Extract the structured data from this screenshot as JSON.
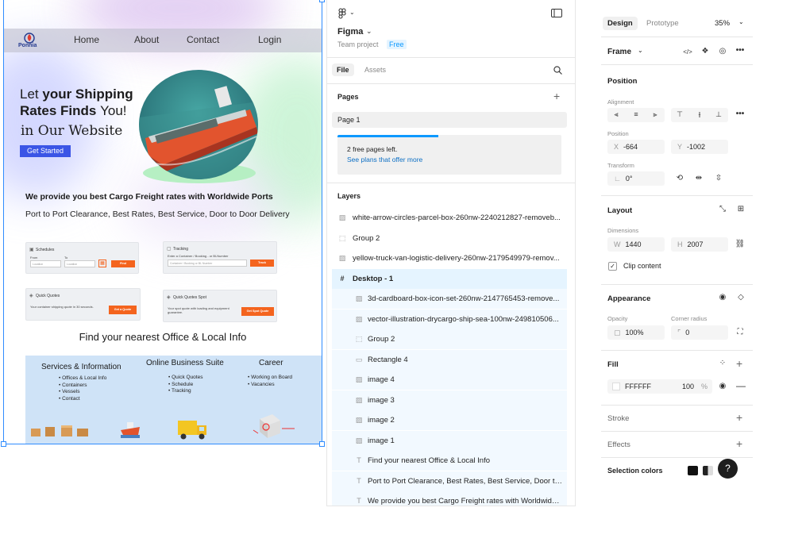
{
  "colors": {
    "accent": "#2f8cff",
    "cta_blue": "#3b55e6",
    "orange": "#f4641e",
    "footer_bg": "#cfe3f7",
    "selected_layer_bg": "#e5f4ff",
    "nested_layer_bg": "#f2f9ff"
  },
  "canvas": {
    "nav": {
      "logo_text": "Ponnia",
      "items": [
        "Home",
        "About",
        "Contact",
        "Login"
      ]
    },
    "hero": {
      "line1_normal": "Let ",
      "line1_bold": "your Shipping",
      "line2_bold": "Rates Finds ",
      "line2_normal": "You!",
      "line3": "in Our Website",
      "cta": "Get Started"
    },
    "tagline": "We provide you best Cargo Freight rates with Worldwide Ports",
    "subline": "Port to Port Clearance, Best Rates, Best Service, Door to Door Delivery",
    "cards": {
      "schedules": {
        "title": "Schedules",
        "from_label": "From",
        "to_label": "To",
        "from_ph": "Location",
        "to_ph": "Location",
        "btn": "Find"
      },
      "tracking": {
        "title": "Tracking",
        "desc": "Enter a Container / Booking - or Bl-Number",
        "ph": "Container / Booking or BL Number",
        "btn": "Track"
      },
      "quick_quotes": {
        "title": "Quick Quotes",
        "desc": "Your container shipping quote in 30 seconds.",
        "btn": "Get a Quote"
      },
      "quick_quotes_spot": {
        "title": "Quick Quotes Spot",
        "desc": "Your spot quote with loading and equipment guarantee.",
        "btn": "Get Spot Quote"
      }
    },
    "office_heading": "Find your nearest Office & Local Info",
    "footer": {
      "col1": {
        "title": "Services & Information",
        "items": [
          "Offices & Local Info",
          "Containers",
          "Vessels",
          "Contact"
        ]
      },
      "col2": {
        "title": "Online Business Suite",
        "items": [
          "Quick Quotes",
          "Schedule",
          "Tracking"
        ]
      },
      "col3": {
        "title": "Career",
        "items": [
          "Working on Board",
          "Vacancies"
        ]
      }
    }
  },
  "left_panel": {
    "app_name": "Figma",
    "project": "Team project",
    "plan_badge": "Free",
    "tabs": [
      "File",
      "Assets"
    ],
    "pages_title": "Pages",
    "page_selected": "Page 1",
    "pages_notice": "2 free pages left.",
    "pages_link": "See plans that offer more",
    "pages_progress": 0.45,
    "layers_title": "Layers",
    "layers": [
      {
        "icon": "image",
        "label": "white-arrow-circles-parcel-box-260nw-2240212827-removeb..."
      },
      {
        "icon": "group",
        "label": "Group 2"
      },
      {
        "icon": "image",
        "label": "yellow-truck-van-logistic-delivery-260nw-2179549979-remov..."
      },
      {
        "icon": "frame",
        "label": "Desktop - 1"
      },
      {
        "icon": "image",
        "label": "3d-cardboard-box-icon-set-260nw-2147765453-remove..."
      },
      {
        "icon": "image",
        "label": "vector-illustration-drycargo-ship-sea-100nw-249810506..."
      },
      {
        "icon": "group",
        "label": "Group 2"
      },
      {
        "icon": "rect",
        "label": "Rectangle 4"
      },
      {
        "icon": "image",
        "label": "image 4"
      },
      {
        "icon": "image",
        "label": "image 3"
      },
      {
        "icon": "image",
        "label": "image 2"
      },
      {
        "icon": "image",
        "label": "image 1"
      },
      {
        "icon": "text",
        "label": "Find your nearest Office & Local Info"
      },
      {
        "icon": "text",
        "label": "Port to Port Clearance, Best Rates, Best Service, Door to ..."
      },
      {
        "icon": "text",
        "label": "We provide you best Cargo Freight rates with Worldwide ..."
      }
    ]
  },
  "right_panel": {
    "tabs": [
      "Design",
      "Prototype"
    ],
    "zoom": "35%",
    "frame_label": "Frame",
    "position_title": "Position",
    "alignment_label": "Alignment",
    "position_label": "Position",
    "x": "-664",
    "y": "-1002",
    "transform_label": "Transform",
    "rotation": "0°",
    "layout_title": "Layout",
    "dimensions_label": "Dimensions",
    "w": "1440",
    "h": "2007",
    "clip_content": "Clip content",
    "appearance_title": "Appearance",
    "opacity_label": "Opacity",
    "opacity": "100%",
    "radius_label": "Corner radius",
    "radius": "0",
    "fill_title": "Fill",
    "fill_hex": "FFFFFF",
    "fill_opacity": "100",
    "fill_pct": "%",
    "stroke_title": "Stroke",
    "effects_title": "Effects",
    "selection_colors_title": "Selection colors",
    "help": "?"
  }
}
